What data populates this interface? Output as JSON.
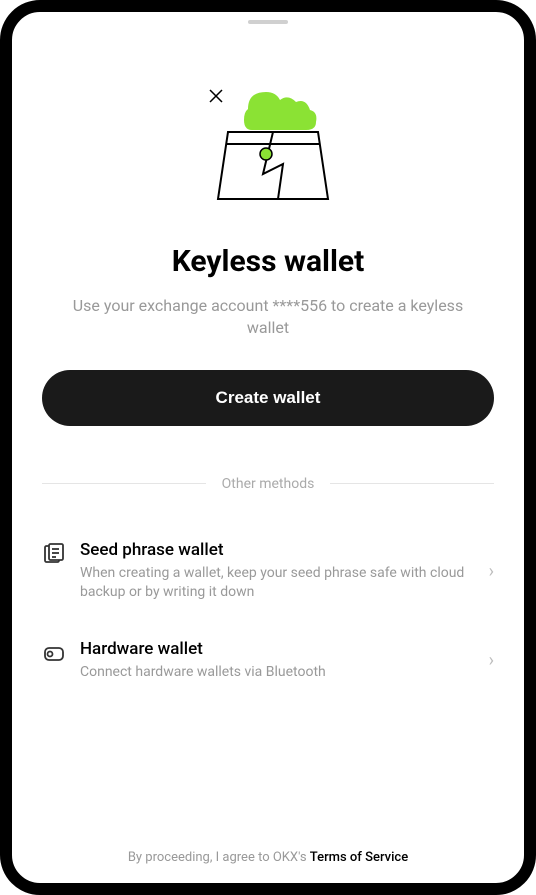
{
  "header": {
    "title": "Keyless wallet",
    "subtitle": "Use your exchange account ****556 to create a keyless wallet"
  },
  "primary_button": {
    "label": "Create wallet"
  },
  "divider": {
    "label": "Other methods"
  },
  "methods": [
    {
      "title": "Seed phrase wallet",
      "description": "When creating a wallet, keep your seed phrase safe with cloud backup or by writing it down"
    },
    {
      "title": "Hardware wallet",
      "description": "Connect hardware wallets via Bluetooth"
    }
  ],
  "footer": {
    "prefix": "By proceeding, I agree to OKX's ",
    "link": "Terms of Service"
  }
}
